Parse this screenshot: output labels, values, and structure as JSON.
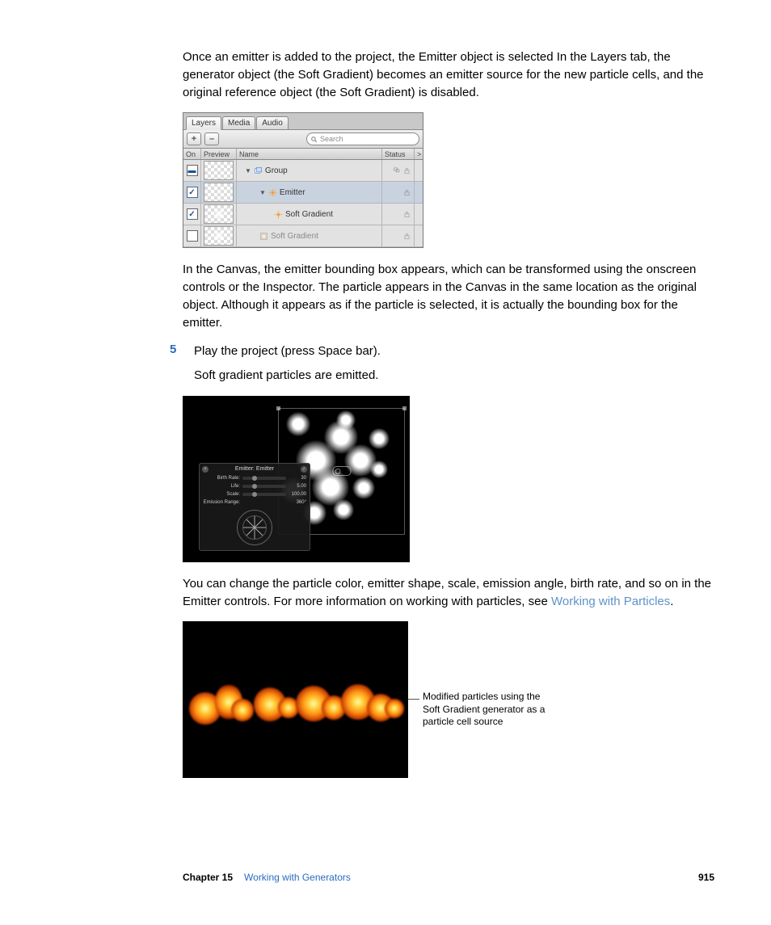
{
  "paragraphs": {
    "intro": "Once an emitter is added to the project, the Emitter object is selected In the Layers tab, the generator object (the Soft Gradient) becomes an emitter source for the new particle cells, and the original reference object (the Soft Gradient) is disabled.",
    "canvas": "In the Canvas, the emitter bounding box appears, which can be transformed using the onscreen controls or the Inspector. The particle appears in the Canvas in the same location as the original object. Although it appears as if the particle is selected, it is actually the bounding box for the emitter.",
    "step5_main": "Play the project (press Space bar).",
    "step5_sub": "Soft gradient particles are emitted.",
    "change_pre": "You can change the particle color, emitter shape, scale, emission angle, birth rate, and so on in the Emitter controls. For more information on working with particles, see ",
    "change_link": "Working with Particles",
    "change_post": "."
  },
  "step_number": "5",
  "layers_panel": {
    "tabs": [
      "Layers",
      "Media",
      "Audio"
    ],
    "add": "+",
    "remove": "–",
    "search_placeholder": "Search",
    "columns": {
      "on": "On",
      "preview": "Preview",
      "name": "Name",
      "status": "Status",
      "more": ">"
    },
    "rows": {
      "group": "Group",
      "emitter": "Emitter",
      "soft1": "Soft Gradient",
      "soft2": "Soft Gradient"
    }
  },
  "hud": {
    "title": "Emitter: Emitter",
    "rows": [
      {
        "label": "Birth Rate:",
        "value": "30"
      },
      {
        "label": "Life:",
        "value": "5.00"
      },
      {
        "label": "Scale:",
        "value": "100.00"
      },
      {
        "label": "Emission Range:",
        "value": "360°"
      }
    ]
  },
  "callout": "Modified particles using the Soft Gradient generator as a particle cell source",
  "footer": {
    "chapter": "Chapter 15",
    "title": "Working with Generators",
    "page": "915"
  }
}
